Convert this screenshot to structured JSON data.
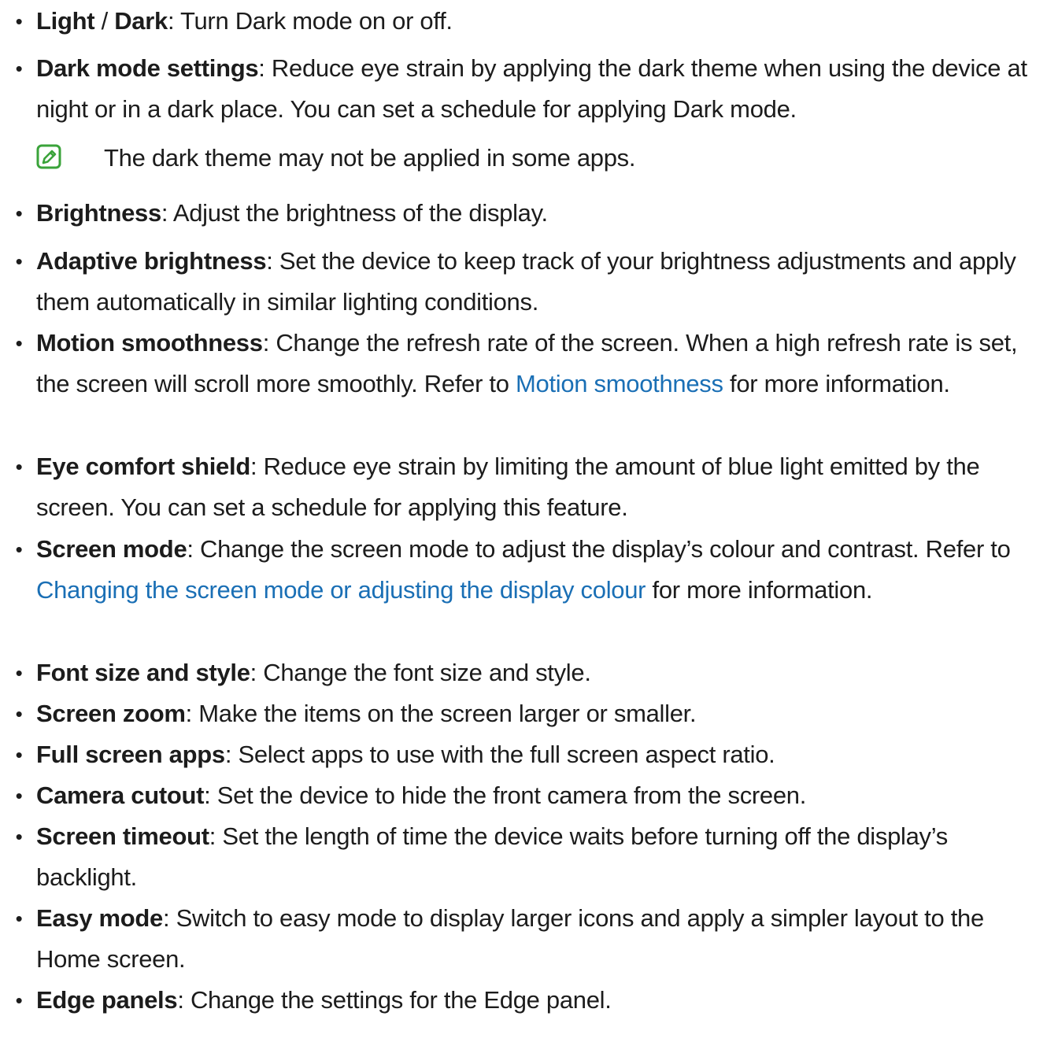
{
  "items": [
    {
      "term": "Light",
      "sep": " / ",
      "term2": "Dark",
      "desc": ": Turn Dark mode on or off."
    },
    {
      "term": "Dark mode settings",
      "desc": ": Reduce eye strain by applying the dark theme when using the device at night or in a dark place. You can set a schedule for applying Dark mode."
    },
    {
      "term": "Brightness",
      "desc": ": Adjust the brightness of the display."
    },
    {
      "term": "Adaptive brightness",
      "desc": ": Set the device to keep track of your brightness adjustments and apply them automatically in similar lighting conditions."
    },
    {
      "term": "Motion smoothness",
      "desc_before": ": Change the refresh rate of the screen. When a high refresh rate is set, the screen will scroll more smoothly. Refer to ",
      "link": "Motion smoothness",
      "desc_after": " for more information."
    },
    {
      "term": "Eye comfort shield",
      "desc": ": Reduce eye strain by limiting the amount of blue light emitted by the screen. You can set a schedule for applying this feature."
    },
    {
      "term": "Screen mode",
      "desc_before": ": Change the screen mode to adjust the display’s colour and contrast. Refer to ",
      "link": "Changing the screen mode or adjusting the display colour",
      "desc_after": " for more information."
    },
    {
      "term": "Font size and style",
      "desc": ": Change the font size and style."
    },
    {
      "term": "Screen zoom",
      "desc": ": Make the items on the screen larger or smaller."
    },
    {
      "term": "Full screen apps",
      "desc": ": Select apps to use with the full screen aspect ratio."
    },
    {
      "term": "Camera cutout",
      "desc": ": Set the device to hide the front camera from the screen."
    },
    {
      "term": "Screen timeout",
      "desc": ": Set the length of time the device waits before turning off the display’s backlight."
    },
    {
      "term": "Easy mode",
      "desc": ": Switch to easy mode to display larger icons and apply a simpler layout to the Home screen."
    },
    {
      "term": "Edge panels",
      "desc": ": Change the settings for the Edge panel."
    }
  ],
  "note": {
    "icon": "note-pencil-icon",
    "text": "The dark theme may not be applied in some apps."
  },
  "bullet": "•",
  "colors": {
    "text": "#1c1c1c",
    "link": "#1a6fb5",
    "note_icon": "#3aa33a"
  }
}
